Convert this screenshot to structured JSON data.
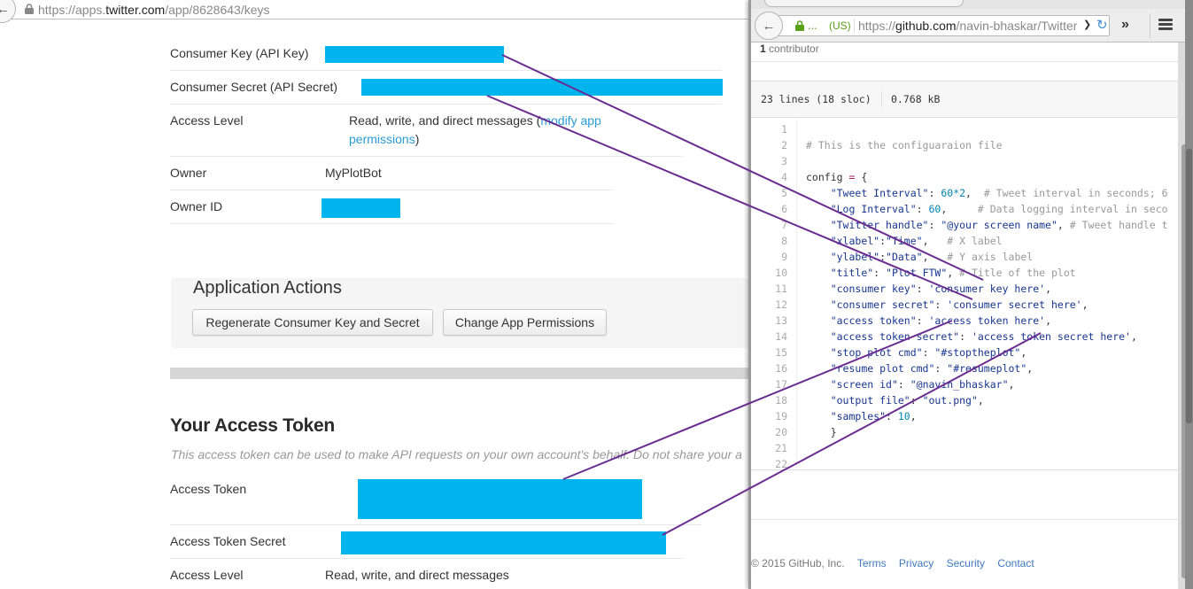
{
  "twitter_window": {
    "url_prefix": "https://apps.",
    "url_domain": "twitter.com",
    "url_path": "/app/8628643/keys",
    "keys_rows": [
      {
        "label": "Consumer Key (API Key)",
        "value": "[redacted]"
      },
      {
        "label": "Consumer Secret (API Secret)",
        "value": "[redacted]"
      },
      {
        "label": "Access Level",
        "value": "Read, write, and direct messages (",
        "link": "modify app",
        "link2": "permissions",
        "suffix": ")"
      },
      {
        "label": "Owner",
        "value": "MyPlotBot"
      },
      {
        "label": "Owner ID",
        "value": "[redacted]"
      }
    ],
    "actions": {
      "title": "Application Actions",
      "regenerate_label": "Regenerate Consumer Key and Secret",
      "change_permissions_label": "Change App Permissions"
    },
    "access_token": {
      "title": "Your Access Token",
      "description": "This access token can be used to make API requests on your own account's behalf. Do not share your a",
      "rows": [
        {
          "label": "Access Token",
          "value": "[redacted]"
        },
        {
          "label": "Access Token Secret",
          "value": "[redacted]"
        },
        {
          "label": "Access Level",
          "value": "Read, write, and direct messages"
        }
      ]
    },
    "redaction_color": "#00b4ed"
  },
  "github_window": {
    "identity_ellipsis": "...",
    "identity_country": "(US)",
    "url_prefix": "https://",
    "url_domain": "github.com",
    "url_path": "/navin-bhaskar/TwitterF",
    "contributors_count": "1",
    "contributors_label": "contributor",
    "file_lines": "23 lines (18 sloc)",
    "file_size": "0.768 kB",
    "code_lines": [
      "",
      "# This is the configuaraion file",
      "",
      "config = {",
      "    \"Tweet Interval\": 60*2,  # Tweet interval in seconds; 6",
      "    \"Log Interval\": 60,     # Data logging interval in seco",
      "    \"Twitter handle\": \"@your screen name\", # Tweet handle t",
      "    \"xlabel\":\"Time\",   # X label",
      "    \"ylabel\":\"Data\",   # Y axis label",
      "    \"title\": \"Plot FTW\", # Title of the plot",
      "    \"consumer key\": 'consumer key here',",
      "    \"consumer secret\": 'consumer secret here',",
      "    \"access token\": 'access token here',",
      "    \"access token secret\": 'access token secret here',",
      "    \"stop plot cmd\": \"#stoptheplot\",",
      "    \"resume plot cmd\": \"#resumeplot\",",
      "    \"screen id\": \"@navin_bhaskar\",",
      "    \"output file\": \"out.png\",",
      "    \"samples\": 10,",
      "    }",
      "",
      ""
    ],
    "footer": {
      "copyright": "© 2015 GitHub, Inc.",
      "links": [
        "Terms",
        "Privacy",
        "Security",
        "Contact"
      ]
    }
  },
  "annotation_color": "#6a2c91"
}
